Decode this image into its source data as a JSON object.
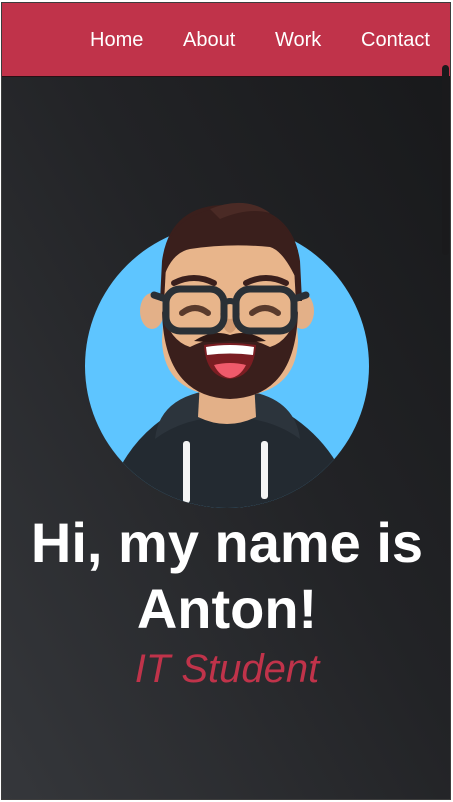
{
  "nav": {
    "items": [
      {
        "label": "Home"
      },
      {
        "label": "About"
      },
      {
        "label": "Work"
      },
      {
        "label": "Contact"
      }
    ]
  },
  "hero": {
    "heading_line1": "Hi, my name is",
    "heading_line2": "Anton!",
    "subtitle": "IT Student",
    "avatar_icon": "cartoon-avatar-icon"
  },
  "colors": {
    "accent": "#c0334a",
    "background_dark": "#222326",
    "text": "#ffffff",
    "avatar_circle": "#5ec5ff"
  }
}
